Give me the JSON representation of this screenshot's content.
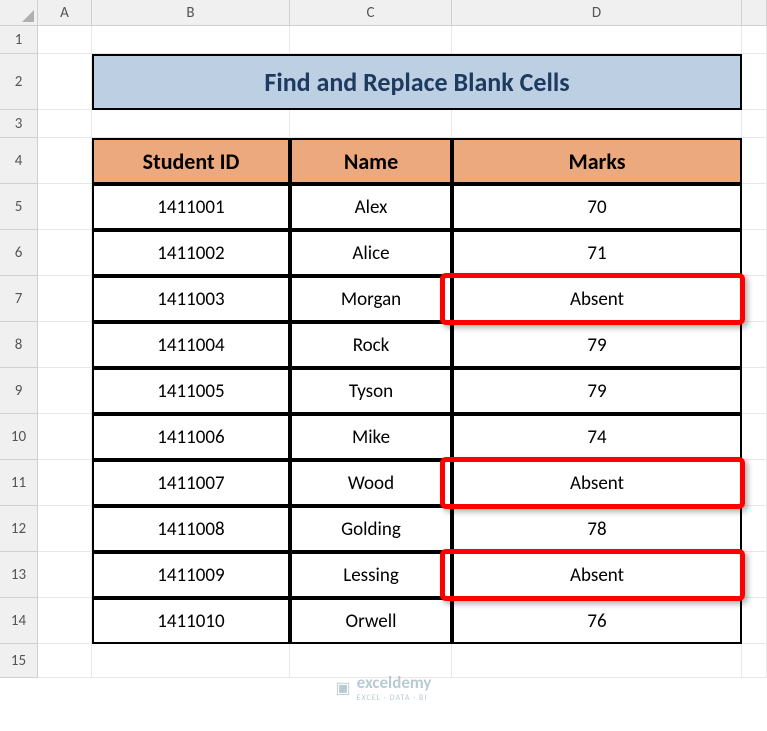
{
  "columns": [
    "A",
    "B",
    "C",
    "D"
  ],
  "rows": [
    "1",
    "2",
    "3",
    "4",
    "5",
    "6",
    "7",
    "8",
    "9",
    "10",
    "11",
    "12",
    "13",
    "14",
    "15"
  ],
  "title": "Find and Replace Blank Cells",
  "headers": {
    "col1": "Student ID",
    "col2": "Name",
    "col3": "Marks"
  },
  "data": [
    {
      "id": "1411001",
      "name": "Alex",
      "marks": "70",
      "hl": false
    },
    {
      "id": "1411002",
      "name": "Alice",
      "marks": "71",
      "hl": false
    },
    {
      "id": "1411003",
      "name": "Morgan",
      "marks": "Absent",
      "hl": true
    },
    {
      "id": "1411004",
      "name": "Rock",
      "marks": "79",
      "hl": false
    },
    {
      "id": "1411005",
      "name": "Tyson",
      "marks": "79",
      "hl": false
    },
    {
      "id": "1411006",
      "name": "Mike",
      "marks": "74",
      "hl": false
    },
    {
      "id": "1411007",
      "name": "Wood",
      "marks": "Absent",
      "hl": true
    },
    {
      "id": "1411008",
      "name": "Golding",
      "marks": "78",
      "hl": false
    },
    {
      "id": "1411009",
      "name": "Lessing",
      "marks": "Absent",
      "hl": true
    },
    {
      "id": "1411010",
      "name": "Orwell",
      "marks": "76",
      "hl": false
    }
  ],
  "watermark": {
    "brand": "exceldemy",
    "sub": "EXCEL · DATA · BI"
  },
  "chart_data": {
    "type": "table",
    "title": "Find and Replace Blank Cells",
    "columns": [
      "Student ID",
      "Name",
      "Marks"
    ],
    "rows": [
      [
        "1411001",
        "Alex",
        "70"
      ],
      [
        "1411002",
        "Alice",
        "71"
      ],
      [
        "1411003",
        "Morgan",
        "Absent"
      ],
      [
        "1411004",
        "Rock",
        "79"
      ],
      [
        "1411005",
        "Tyson",
        "79"
      ],
      [
        "1411006",
        "Mike",
        "74"
      ],
      [
        "1411007",
        "Wood",
        "Absent"
      ],
      [
        "1411008",
        "Golding",
        "78"
      ],
      [
        "1411009",
        "Lessing",
        "Absent"
      ],
      [
        "1411010",
        "Orwell",
        "76"
      ]
    ],
    "highlighted_rows": [
      2,
      6,
      8
    ]
  }
}
